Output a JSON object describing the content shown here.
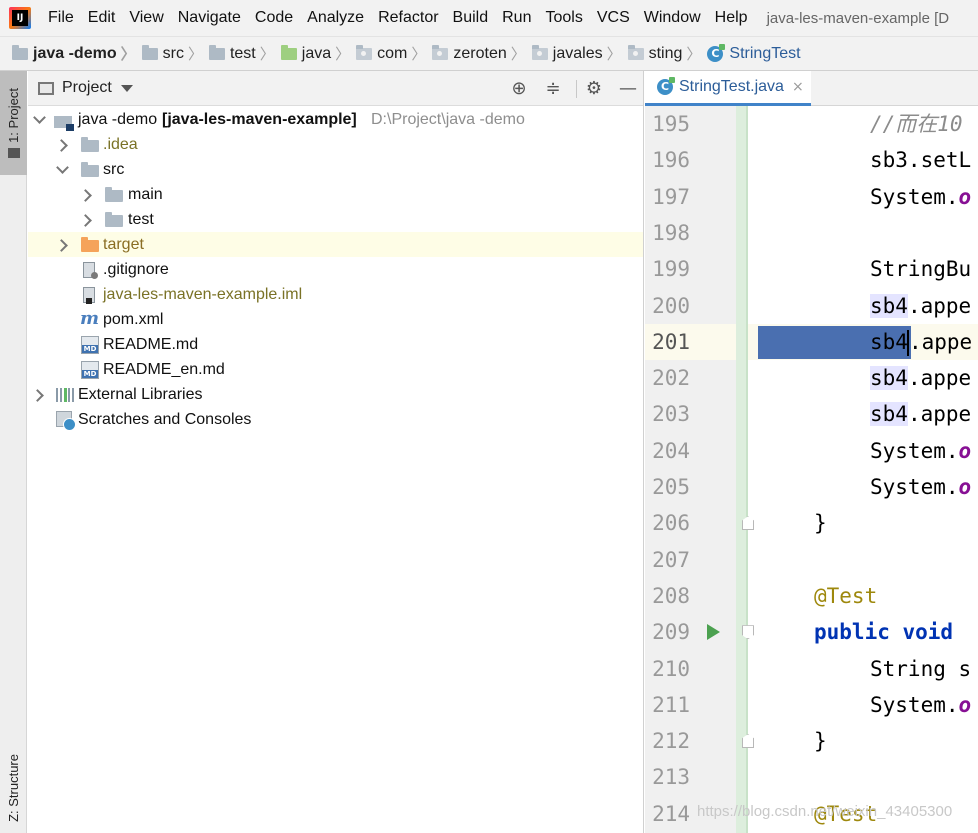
{
  "menubar": {
    "items": [
      "File",
      "Edit",
      "View",
      "Navigate",
      "Code",
      "Analyze",
      "Refactor",
      "Build",
      "Run",
      "Tools",
      "VCS",
      "Window",
      "Help"
    ],
    "window_title": "java-les-maven-example [D"
  },
  "breadcrumb": [
    "java -demo",
    "src",
    "test",
    "java",
    "com",
    "zeroten",
    "javales",
    "sting",
    "StringTest"
  ],
  "left_strip": {
    "project_tab": "1: Project",
    "structure_tab": "Z: Structure"
  },
  "project_panel": {
    "title": "Project",
    "tree": [
      {
        "label": "java -demo",
        "suffix": "[java-les-maven-example]",
        "path": "D:\\Project\\java -demo"
      },
      {
        "label": ".idea"
      },
      {
        "label": "src"
      },
      {
        "label": "main"
      },
      {
        "label": "test"
      },
      {
        "label": "target"
      },
      {
        "label": ".gitignore"
      },
      {
        "label": "java-les-maven-example.iml"
      },
      {
        "label": "pom.xml"
      },
      {
        "label": "README.md"
      },
      {
        "label": "README_en.md"
      },
      {
        "label": "External Libraries"
      },
      {
        "label": "Scratches and Consoles"
      }
    ]
  },
  "editor": {
    "tab_label": "StringTest.java",
    "tab_close": "×",
    "current_line": 201,
    "lines": [
      {
        "num": "195",
        "code": "//而在10"
      },
      {
        "num": "196",
        "code": "sb3.setL"
      },
      {
        "num": "197",
        "pre": "System.",
        "purple": "o"
      },
      {
        "num": "198",
        "code": ""
      },
      {
        "num": "199",
        "code": "StringBu"
      },
      {
        "num": "200",
        "var": "sb4",
        "rest": ".appe"
      },
      {
        "num": "201",
        "var": "sb4",
        "rest": ".appe"
      },
      {
        "num": "202",
        "var": "sb4",
        "rest": ".appe"
      },
      {
        "num": "203",
        "var": "sb4",
        "rest": ".appe"
      },
      {
        "num": "204",
        "pre": "System.",
        "purple": "o"
      },
      {
        "num": "205",
        "pre": "System.",
        "purple": "o"
      },
      {
        "num": "206",
        "code": "}"
      },
      {
        "num": "207",
        "code": ""
      },
      {
        "num": "208",
        "anno": "@Test"
      },
      {
        "num": "209",
        "kw": "public void"
      },
      {
        "num": "210",
        "code": "String s"
      },
      {
        "num": "211",
        "pre": "System.",
        "purple": "o"
      },
      {
        "num": "212",
        "code": "}"
      },
      {
        "num": "213",
        "code": ""
      },
      {
        "num": "214",
        "anno": "@Test"
      }
    ]
  },
  "watermark": "https://blog.csdn.net/weixin_43405300"
}
